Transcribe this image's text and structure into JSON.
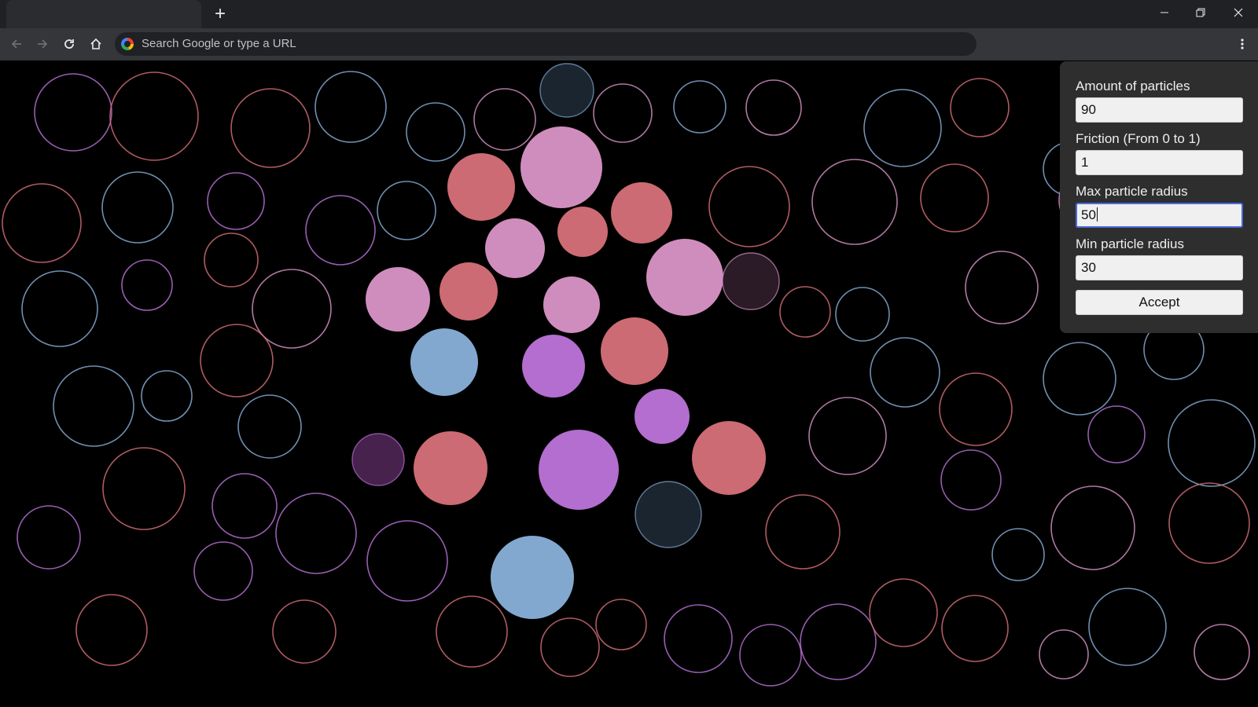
{
  "browser": {
    "tab_title": "",
    "new_tab_label": "+",
    "omnibox_placeholder": "Search Google or type a URL"
  },
  "settings_panel": {
    "amount_label": "Amount of particles",
    "amount_value": "90",
    "friction_label": "Friction (From 0 to 1)",
    "friction_value": "1",
    "max_radius_label": "Max particle radius",
    "max_radius_value": "50",
    "min_radius_label": "Min particle radius",
    "min_radius_value": "30",
    "accept_label": "Accept"
  },
  "colors": {
    "blue": "#82a8cf",
    "pink": "#cf8dbd",
    "red": "#cc6b73",
    "purple": "#b36ecf",
    "dark_navy": "#1b2530",
    "dark_plum": "#2a1b26",
    "dark_purple": "#47224d"
  }
}
